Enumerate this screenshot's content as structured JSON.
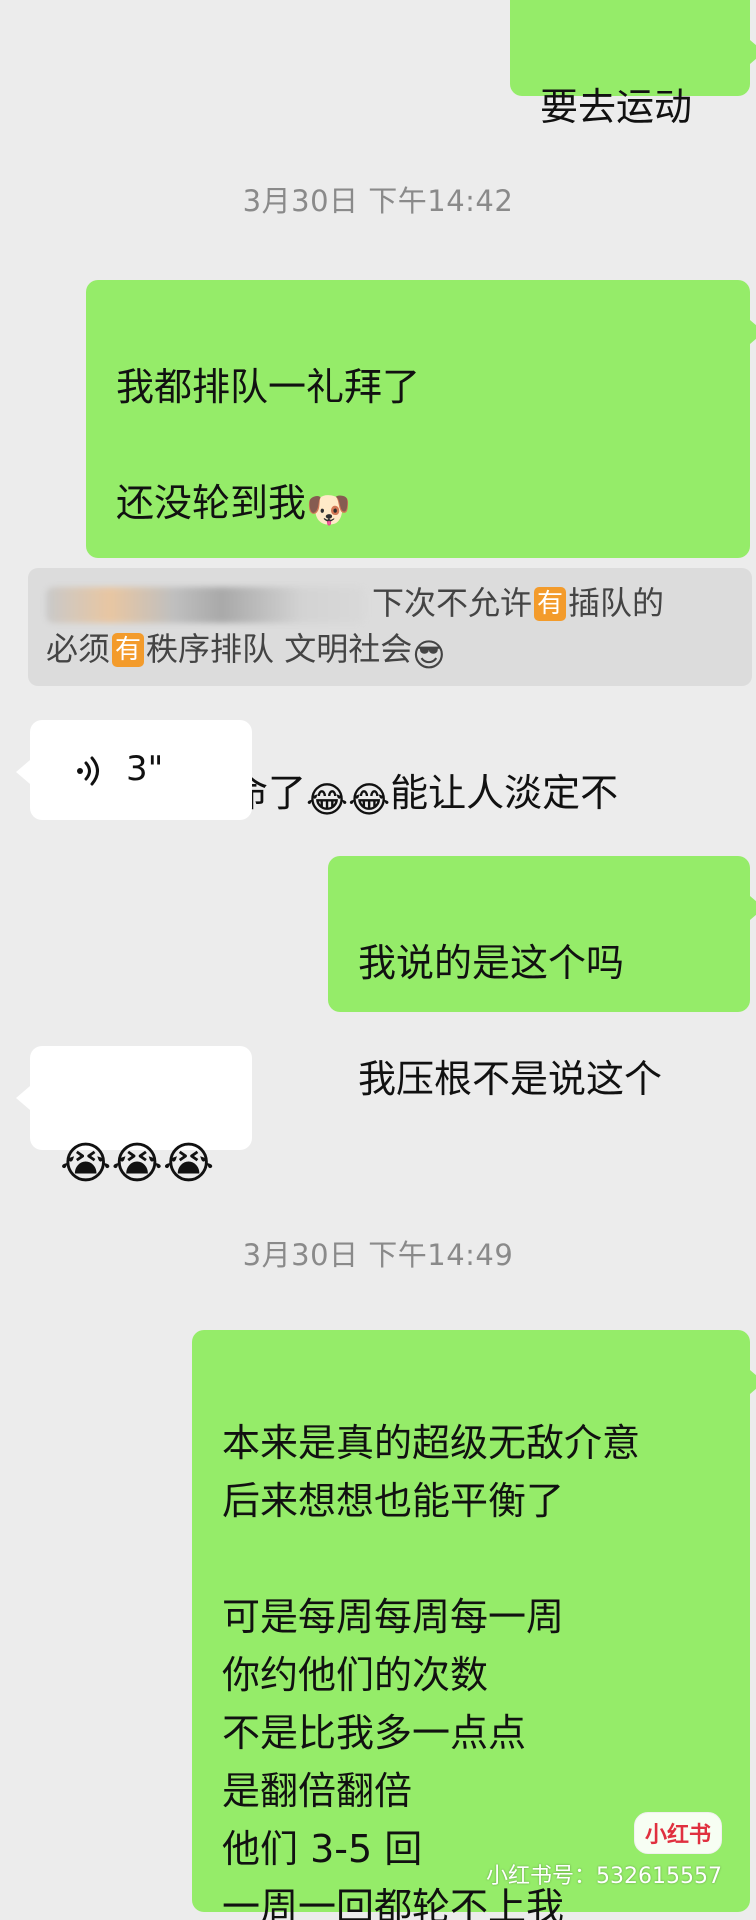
{
  "messages": {
    "m1": "要去运动",
    "t1": "3月30日 下午14:42",
    "m2_line1": "我都排队一礼拜了",
    "m2_line2": "还没轮到我",
    "m2_line3": "谁不要命了",
    "m2_line3_tail": "能让人淡定不",
    "quote_part1": "下次不允许",
    "quote_you": "有",
    "quote_part2": "插队的",
    "quote_line2a": "必须",
    "quote_line2b": "秩序排队 文明社会",
    "voice_duration": "3\"",
    "m3_line1": "我说的是这个吗",
    "m3_line2": "我压根不是说这个",
    "t2": "3月30日 下午14:49",
    "m4": "本来是真的超级无敌介意\n后来想想也能平衡了\n\n可是每周每周每一周\n你约他们的次数\n不是比我多一点点\n是翻倍翻倍\n他们 3-5 回\n一周一回都轮不上我"
  },
  "emojis": {
    "doge": "🐶",
    "tears": "😂",
    "cool": "😎",
    "cry": "😭"
  },
  "watermark": {
    "logo": "小红书",
    "id": "小红书号：532615557"
  }
}
